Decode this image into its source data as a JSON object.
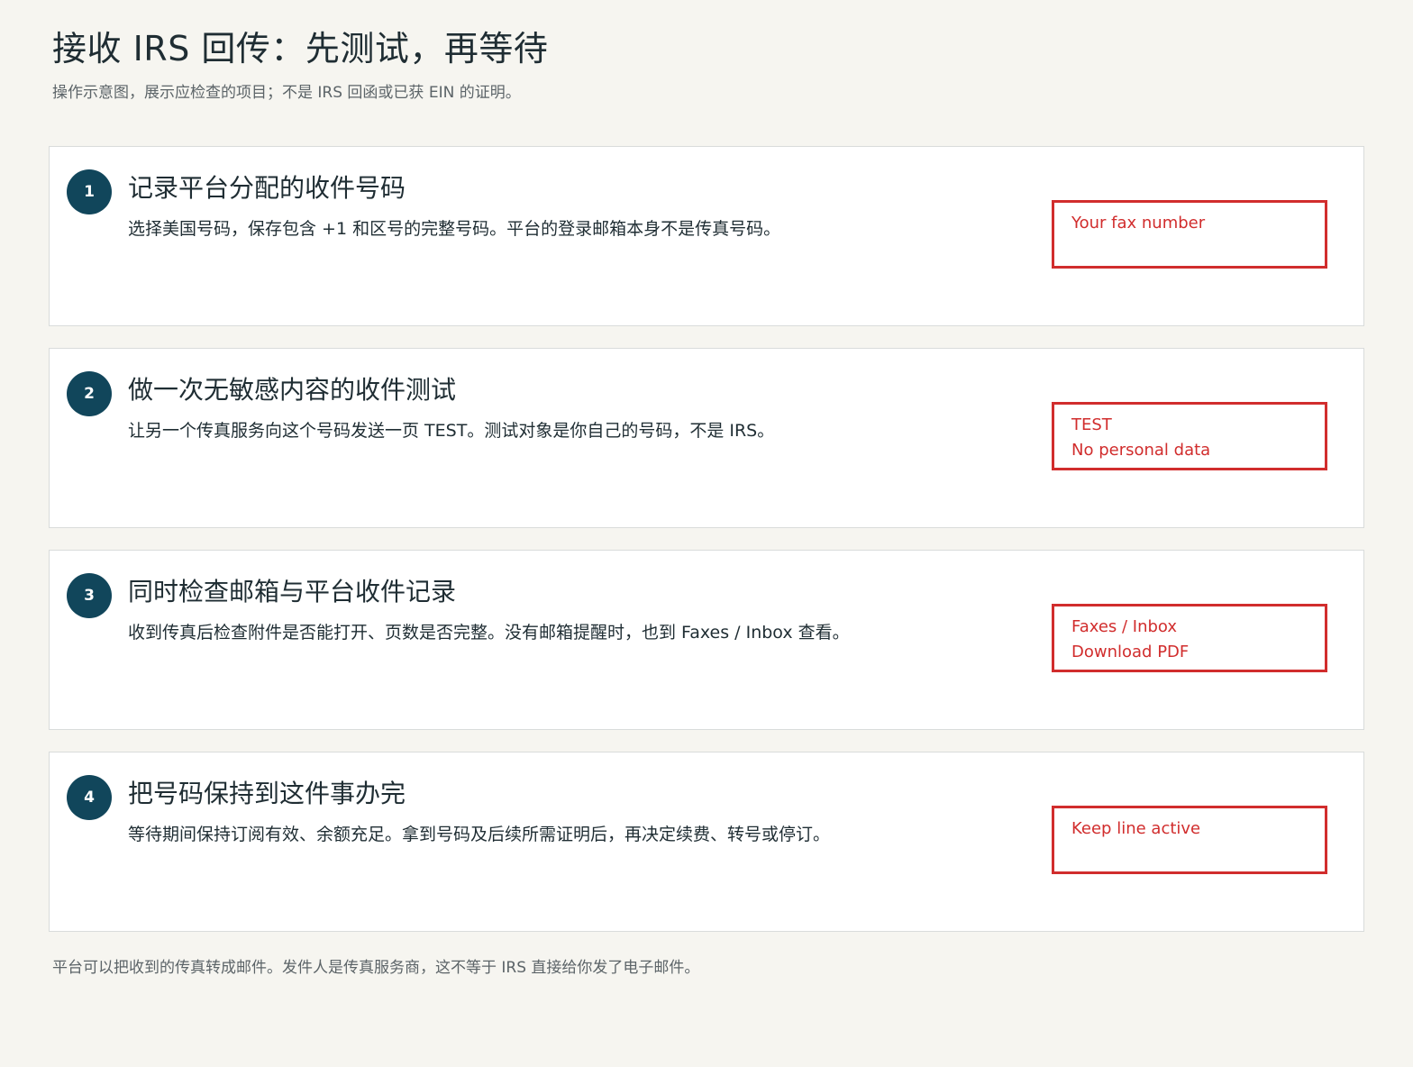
{
  "header": {
    "title": "接收 IRS 回传：先测试，再等待",
    "subtitle": "操作示意图，展示应检查的项目；不是 IRS 回函或已获 EIN 的证明。"
  },
  "steps": [
    {
      "number": "1",
      "title": "记录平台分配的收件号码",
      "description": "选择美国号码，保存包含 +1 和区号的完整号码。平台的登录邮箱本身不是传真号码。",
      "box_lines": [
        "Your fax number",
        ""
      ]
    },
    {
      "number": "2",
      "title": "做一次无敏感内容的收件测试",
      "description": "让另一个传真服务向这个号码发送一页 TEST。测试对象是你自己的号码，不是 IRS。",
      "box_lines": [
        "TEST",
        "No personal data"
      ]
    },
    {
      "number": "3",
      "title": "同时检查邮箱与平台收件记录",
      "description": "收到传真后检查附件是否能打开、页数是否完整。没有邮箱提醒时，也到 Faxes / Inbox 查看。",
      "box_lines": [
        "Faxes / Inbox",
        "Download PDF"
      ]
    },
    {
      "number": "4",
      "title": "把号码保持到这件事办完",
      "description": "等待期间保持订阅有效、余额充足。拿到号码及后续所需证明后，再决定续费、转号或停订。",
      "box_lines": [
        "Keep line active",
        ""
      ]
    }
  ],
  "footer": {
    "note": "平台可以把收到的传真转成邮件。发件人是传真服务商，这不等于 IRS 直接给你发了电子邮件。"
  },
  "colors": {
    "page_background": "#f6f5f0",
    "card_background": "#ffffff",
    "step_circle": "#11465b",
    "label_box_red": "#d12d2d",
    "text_dark": "#1f2d33",
    "text_muted": "#5c6468"
  }
}
